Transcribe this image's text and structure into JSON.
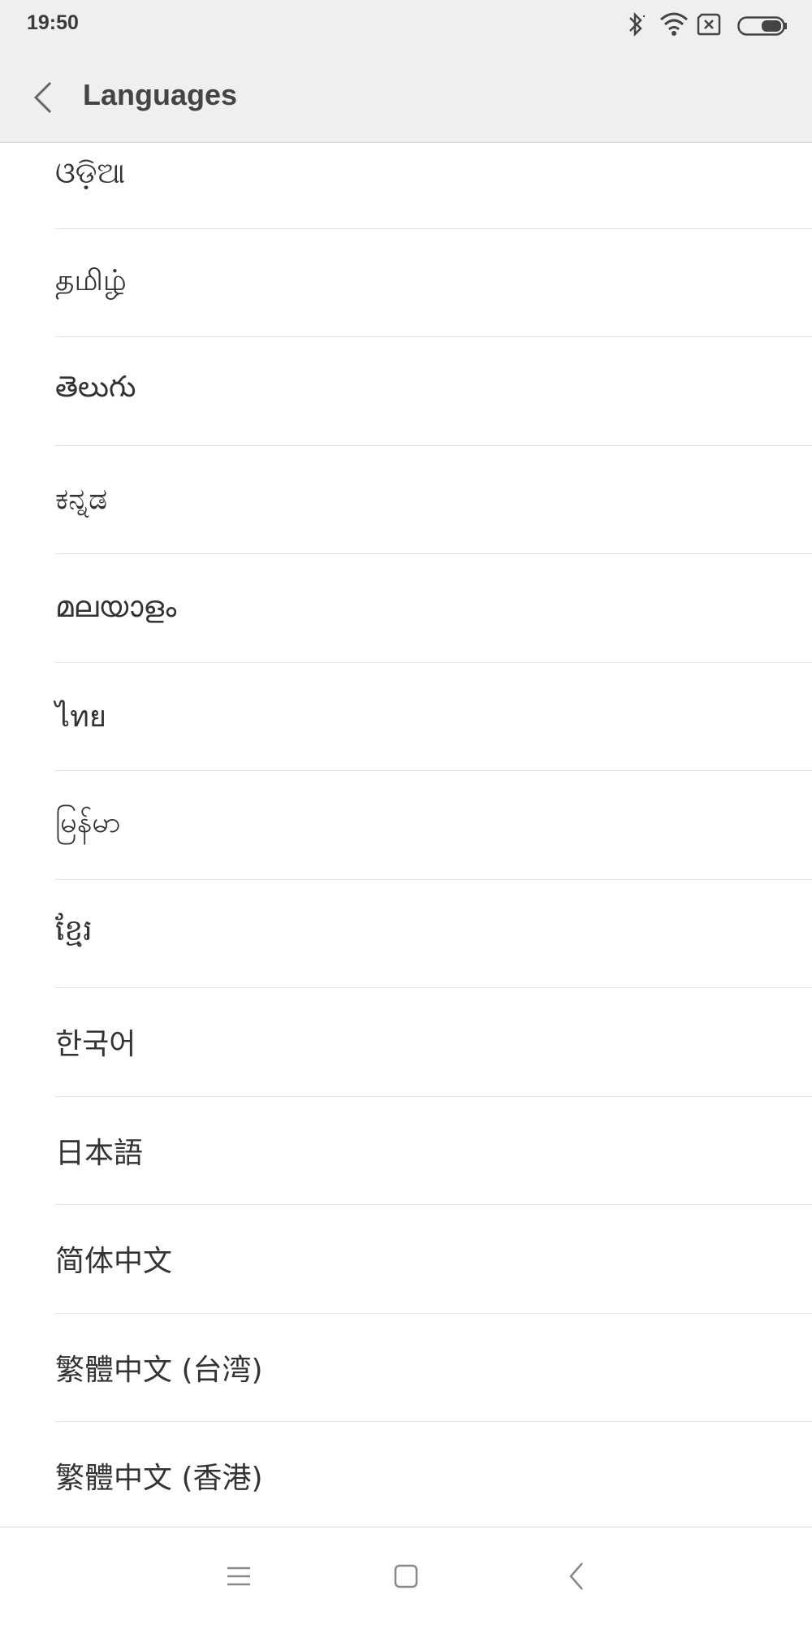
{
  "status_bar": {
    "time": "19:50",
    "icons": [
      "bluetooth-icon",
      "wifi-icon",
      "no-sim-icon",
      "battery-icon"
    ]
  },
  "header": {
    "back_icon": "chevron-left-icon",
    "title": "Languages"
  },
  "languages": [
    "ଓଡ଼ିଆ",
    "தமிழ்",
    "తెలుగు",
    "ಕನ್ನಡ",
    "മലയാളം",
    "ไทย",
    "မြန်မာ",
    "ខ្មែរ",
    "한국어",
    "日本語",
    "简体中文",
    "繁體中文 (台湾)",
    "繁體中文 (香港)"
  ],
  "nav_bar": {
    "icons": [
      "menu-icon",
      "home-icon",
      "back-icon"
    ]
  },
  "colors": {
    "header_bg": "#efefef",
    "list_bg": "#ffffff",
    "divider": "#e3e3e3",
    "text": "#333333"
  }
}
